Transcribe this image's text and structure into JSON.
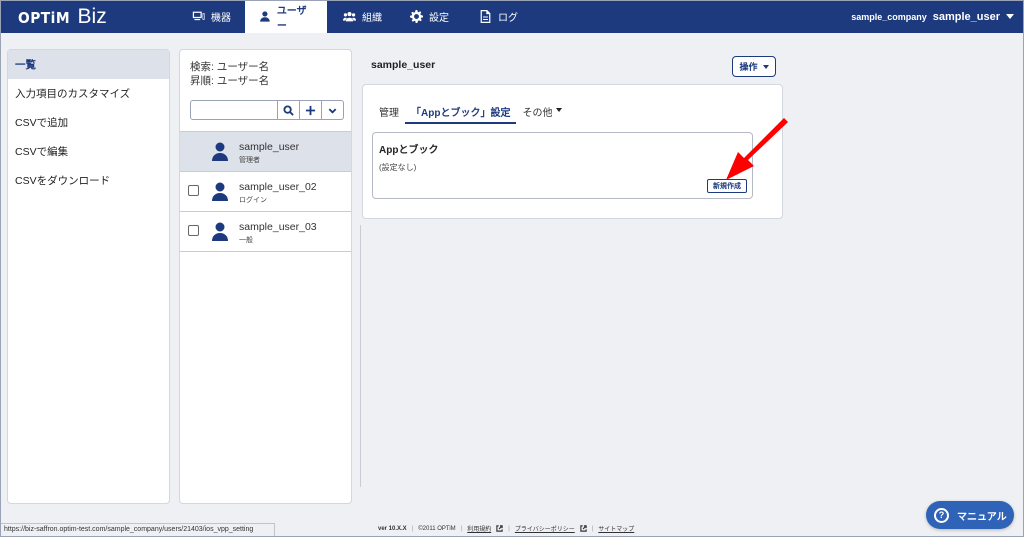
{
  "header": {
    "logo_brand": "OPTiM",
    "logo_product": "Biz",
    "nav": [
      {
        "label": "機器",
        "icon": "monitor-icon"
      },
      {
        "label": "ユーザー",
        "icon": "user-icon"
      },
      {
        "label": "組織",
        "icon": "group-icon"
      },
      {
        "label": "設定",
        "icon": "gear-icon"
      },
      {
        "label": "ログ",
        "icon": "document-icon"
      }
    ],
    "company": "sample_company",
    "user": "sample_user"
  },
  "sidebar": {
    "items": [
      {
        "label": "一覧"
      },
      {
        "label": "入力項目のカスタマイズ"
      },
      {
        "label": "CSVで追加"
      },
      {
        "label": "CSVで編集"
      },
      {
        "label": "CSVをダウンロード"
      }
    ]
  },
  "userlist": {
    "search_label": "検索: ユーザー名",
    "sort_label": "昇順: ユーザー名",
    "search_value": "",
    "users": [
      {
        "name": "sample_user",
        "role": "管理者"
      },
      {
        "name": "sample_user_02",
        "role": "ログイン"
      },
      {
        "name": "sample_user_03",
        "role": "一般"
      }
    ]
  },
  "main": {
    "title": "sample_user",
    "ops_label": "操作",
    "tabs": [
      {
        "label": "管理"
      },
      {
        "label": "「Appとブック」設定"
      },
      {
        "label": "その他"
      }
    ],
    "card": {
      "title": "Appとブック",
      "empty_text": "(設定なし)",
      "new_button": "新規作成"
    }
  },
  "footer": {
    "status_url": "https://biz-saffron.optim-test.com/sample_company/users/21403/ios_vpp_setting",
    "version": "ver 10.X.X",
    "copyright": "©2011 OPTiM",
    "terms": "利用規約",
    "privacy": "プライバシーポリシー",
    "sitemap": "サイトマップ",
    "manual": "マニュアル"
  },
  "colors": {
    "header_bg": "#1d3a7e",
    "accent": "#1d3a7e",
    "annotation_arrow": "#ff0000",
    "manual_button": "#2f63b8"
  }
}
